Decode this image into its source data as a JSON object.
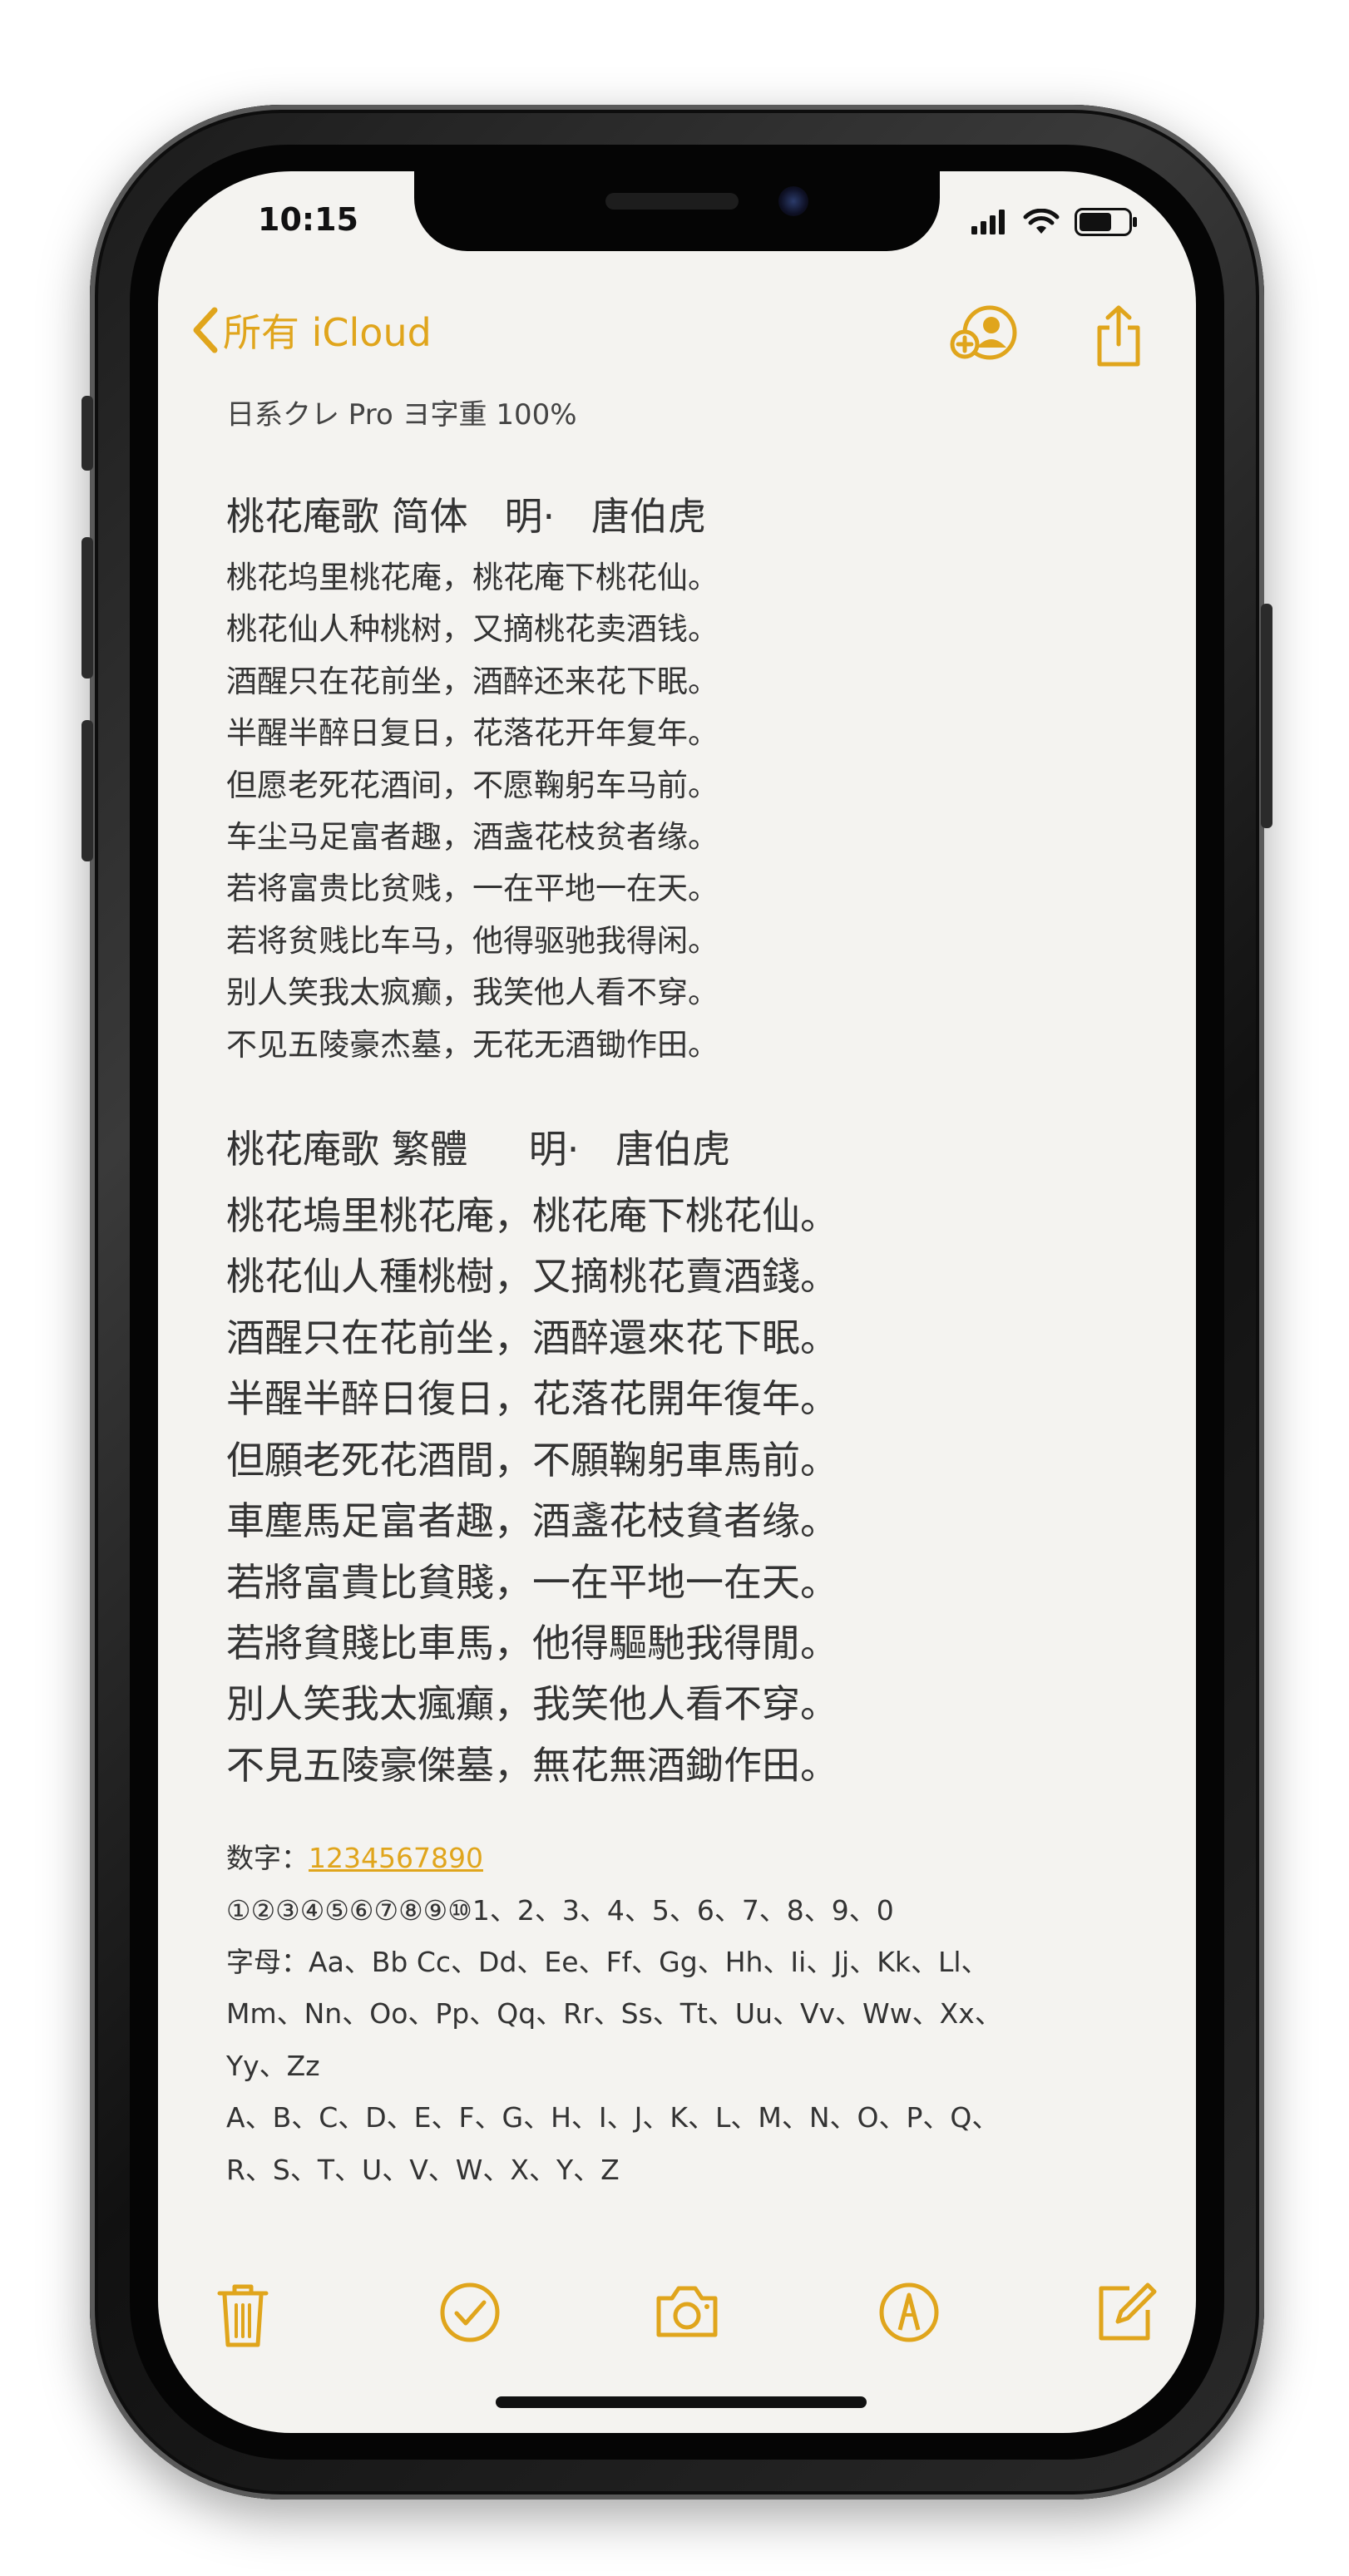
{
  "status_bar": {
    "time": "10:15"
  },
  "nav": {
    "back_label": "所有 iCloud"
  },
  "note": {
    "meta": "日系クレ Pro ヨ字重 100%",
    "simplified": {
      "title": "桃花庵歌 简体   明·   唐伯虎",
      "lines": [
        "桃花坞里桃花庵，桃花庵下桃花仙。",
        "桃花仙人种桃树，又摘桃花卖酒钱。",
        "酒醒只在花前坐，酒醉还来花下眠。",
        "半醒半醉日复日，花落花开年复年。",
        "但愿老死花酒间，不愿鞠躬车马前。",
        "车尘马足富者趣，酒盏花枝贫者缘。",
        "若将富贵比贫贱，一在平地一在天。",
        "若将贫贱比车马，他得驱驰我得闲。",
        "别人笑我太疯癫，我笑他人看不穿。",
        "不见五陵豪杰墓，无花无酒锄作田。"
      ]
    },
    "traditional": {
      "title": "桃花庵歌 繁體     明·   唐伯虎",
      "lines": [
        "桃花塢里桃花庵，桃花庵下桃花仙。",
        "桃花仙人種桃樹，又摘桃花賣酒錢。",
        "酒醒只在花前坐，酒醉還來花下眠。",
        "半醒半醉日復日，花落花開年復年。",
        "但願老死花酒間，不願鞠躬車馬前。",
        "車塵馬足富者趣，酒盞花枝貧者缘。",
        "若將富貴比貧賤，一在平地一在天。",
        "若將貧賤比車馬，他得驅馳我得閒。",
        "別人笑我太瘋癲，我笑他人看不穿。",
        "不見五陵豪傑墓，無花無酒鋤作田。"
      ]
    },
    "numbers_label": "数字：",
    "numbers_link": "1234567890",
    "circled_line": "①②③④⑤⑥⑦⑧⑨⑩1、2、3、4、5、6、7、8、9、0",
    "letters_line_1": "字母：Aa、Bb Cc、Dd、Ee、Ff、Gg、Hh、Ii、Jj、Kk、Ll、",
    "letters_line_2": "Mm、Nn、Oo、Pp、Qq、Rr、Ss、Tt、Uu、Vv、Ww、Xx、",
    "letters_line_3": "Yy、Zz",
    "upper_line_1": "A、B、C、D、E、F、G、H、I、J、K、L、M、N、O、P、Q、",
    "upper_line_2": "R、S、T、U、V、W、X、Y、Z"
  },
  "colors": {
    "accent": "#e0a51c",
    "text": "#333333",
    "paper": "#f4f3f0"
  },
  "icons": {
    "back": "chevron-left-icon",
    "add_person": "add-person-icon",
    "share": "share-icon",
    "trash": "trash-icon",
    "checklist": "checkmark-circle-icon",
    "camera": "camera-icon",
    "markup": "pen-circle-icon",
    "compose": "compose-icon"
  }
}
